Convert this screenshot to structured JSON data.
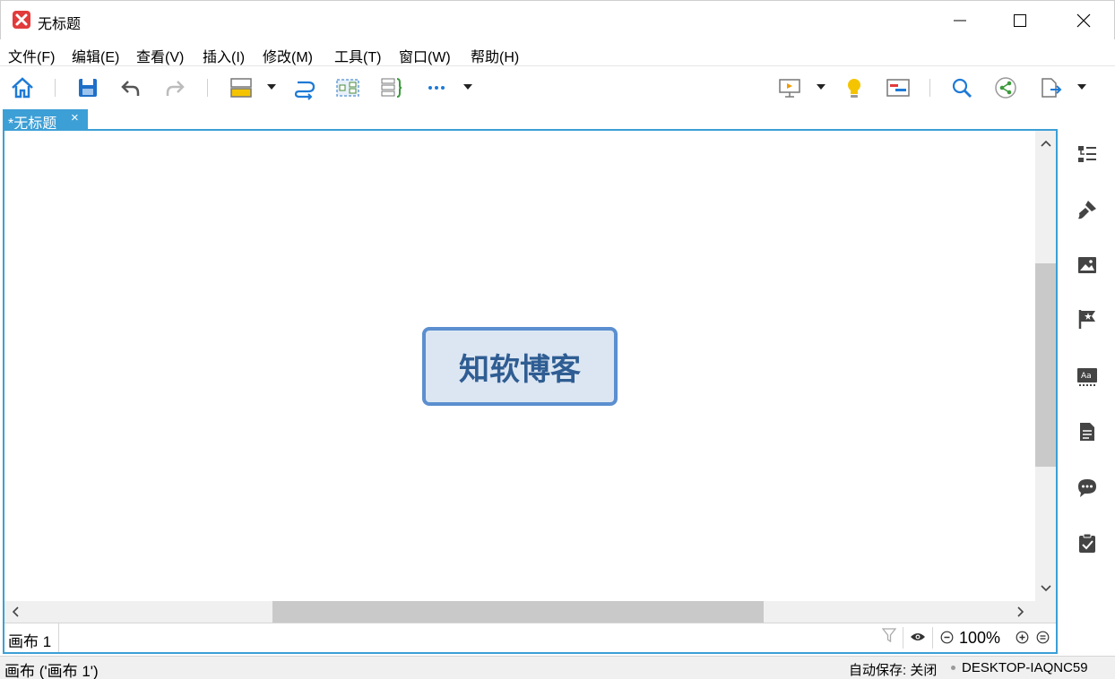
{
  "window": {
    "title": "无标题",
    "accent": "#3c9fd6"
  },
  "menu": {
    "items": [
      "文件(F)",
      "编辑(E)",
      "查看(V)",
      "插入(I)",
      "修改(M)",
      "工具(T)",
      "窗口(W)",
      "帮助(H)"
    ]
  },
  "toolbar": {
    "icons": [
      "home-icon",
      "save-icon",
      "undo-icon",
      "redo-icon",
      "topic-icon",
      "relationship-icon",
      "boundary-icon",
      "summary-icon",
      "more-icon",
      "presentation-icon",
      "brainstorm-icon",
      "gantt-icon",
      "search-icon",
      "share-icon",
      "export-icon"
    ]
  },
  "tab": {
    "label": "*无标题",
    "close": "×"
  },
  "canvas": {
    "central_topic": "知软博客",
    "topic_fill": "#dce6f2",
    "topic_border": "#5b8fcf",
    "topic_text_color": "#2f5d93"
  },
  "sheetbar": {
    "sheet_label": "画布 1",
    "zoom": "100%"
  },
  "right_panel": {
    "icons": [
      "outline-icon",
      "format-brush-icon",
      "image-icon",
      "marker-flag-icon",
      "text-style-icon",
      "notes-icon",
      "comment-icon",
      "task-icon"
    ]
  },
  "status": {
    "left": "画布 ('画布 1')",
    "autosave": "自动保存: 关闭",
    "host": "DESKTOP-IAQNC59"
  }
}
